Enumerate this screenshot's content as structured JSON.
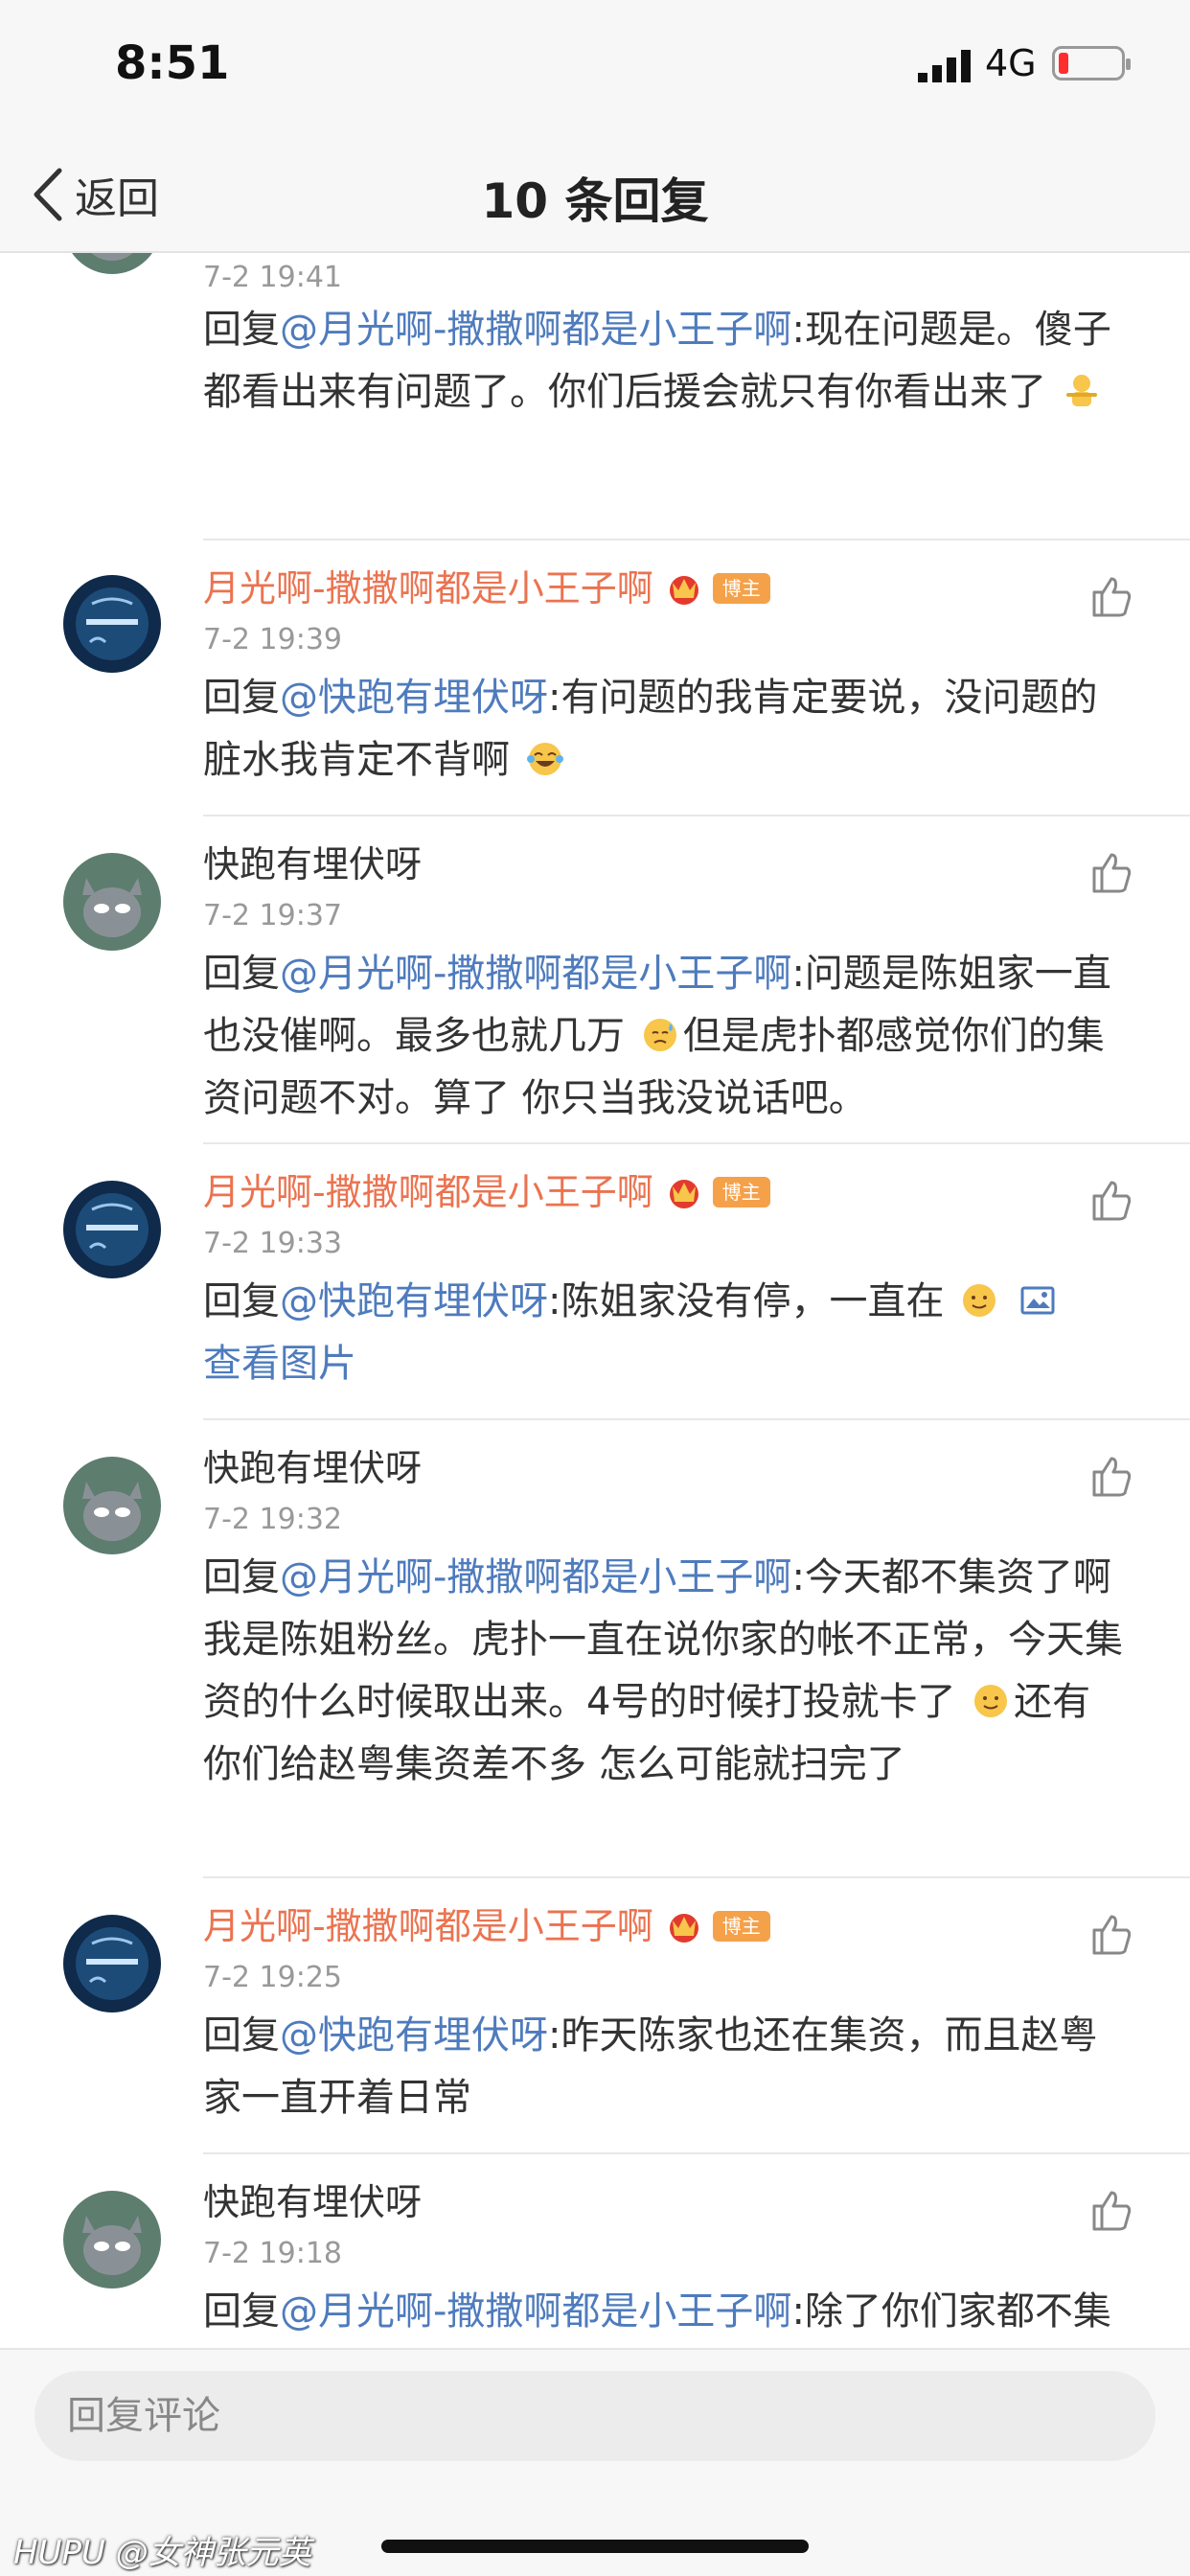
{
  "status_bar": {
    "time": "8:51",
    "network": "4G",
    "battery_color": "#ff2d2d"
  },
  "nav": {
    "back_label": "返回",
    "title": "10 条回复"
  },
  "comments": [
    {
      "author": "",
      "time": "7-2 19:41",
      "reply_prefix": "回复",
      "mention": "@月光啊-撒撒啊都是小王子啊",
      "text": ":现在问题是。傻子都看出来有问题了。你们后援会就只有你看出来了",
      "emoji": "shrug-emoji"
    },
    {
      "author": "月光啊-撒撒啊都是小王子啊",
      "badge": "博主",
      "time": "7-2 19:39",
      "reply_prefix": "回复",
      "mention": "@快跑有埋伏呀",
      "text": ":有问题的我肯定要说，没问题的脏水我肯定不背啊",
      "emoji": "laugh-cry-emoji"
    },
    {
      "author": "快跑有埋伏呀",
      "time": "7-2 19:37",
      "reply_prefix": "回复",
      "mention": "@月光啊-撒撒啊都是小王子啊",
      "text_a": ":问题是陈姐家一直也没催啊。最多也就几万",
      "text_b": "但是虎扑都感觉你们的集资问题不对。算了 你只当我没说话吧。",
      "emoji": "sweat-emoji"
    },
    {
      "author": "月光啊-撒撒啊都是小王子啊",
      "badge": "博主",
      "time": "7-2 19:33",
      "reply_prefix": "回复",
      "mention": "@快跑有埋伏呀",
      "text": ":陈姐家没有停，一直在",
      "link": "查看图片",
      "emoji": "smile-emoji"
    },
    {
      "author": "快跑有埋伏呀",
      "time": "7-2 19:32",
      "reply_prefix": "回复",
      "mention": "@月光啊-撒撒啊都是小王子啊",
      "text_a": ":今天都不集资了啊 我是陈姐粉丝。虎扑一直在说你家的帐不正常，今天集资的什么时候取出来。4号的时候打投就卡了",
      "text_b": "还有你们给赵粤集资差不多 怎么可能就扫完了",
      "emoji": "smile-emoji"
    },
    {
      "author": "月光啊-撒撒啊都是小王子啊",
      "badge": "博主",
      "time": "7-2 19:25",
      "reply_prefix": "回复",
      "mention": "@快跑有埋伏呀",
      "text": ":昨天陈家也还在集资，而且赵粤家一直开着日常"
    },
    {
      "author": "快跑有埋伏呀",
      "time": "7-2 19:18",
      "reply_prefix": "回复",
      "mention": "@月光啊-撒撒啊都是小王子啊",
      "text": ":除了你们家都不集资了",
      "emoji": "sweat-emoji"
    }
  ],
  "reply_bar": {
    "placeholder": "回复评论"
  },
  "watermark": "HUPU @女神张元英",
  "colors": {
    "blogger_name": "#eb7350",
    "mention": "#4e7bbd",
    "badge": "#f5a14a"
  }
}
